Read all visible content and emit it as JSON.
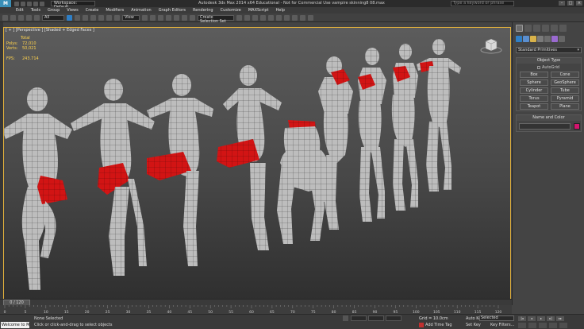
{
  "title_bar": {
    "app_logo": "3ds-max-logo",
    "workspace": "Workspace: Default",
    "title": "Autodesk 3ds Max  2014 x64  Educational - Not for Commercial Use   vampire skinning8 08.max",
    "search_placeholder": "Type a keyword or phrase"
  },
  "menu": [
    "Edit",
    "Tools",
    "Group",
    "Views",
    "Create",
    "Modifiers",
    "Animation",
    "Graph Editors",
    "Rendering",
    "Customize",
    "MAXScript",
    "Help"
  ],
  "toolbar": {
    "selection_filter": "All",
    "ref_coord": "View",
    "named_selection": "Create Selection Set"
  },
  "viewport": {
    "label": "[ + ] [Perspective ] [Shaded + Edged Faces ]",
    "stats": {
      "header": "Total",
      "polys_label": "Polys:",
      "polys": "72,010",
      "verts_label": "Verts:",
      "verts": "50,021",
      "fps_label": "FPS:",
      "fps": "243.714"
    }
  },
  "command_panel": {
    "category": "Standard Primitives",
    "object_type_header": "Object Type",
    "autogrid": "AutoGrid",
    "buttons": [
      "Box",
      "Cone",
      "Sphere",
      "GeoSphere",
      "Cylinder",
      "Tube",
      "Torus",
      "Pyramid",
      "Teapot",
      "Plane"
    ],
    "name_color_header": "Name and Color",
    "color": "#d4146e"
  },
  "timeline": {
    "frame": "0 / 120",
    "ticks": [
      "0",
      "5",
      "10",
      "15",
      "20",
      "25",
      "30",
      "35",
      "40",
      "45",
      "50",
      "55",
      "60",
      "65",
      "70",
      "75",
      "80",
      "85",
      "90",
      "95",
      "100",
      "105",
      "110",
      "115",
      "120"
    ]
  },
  "status": {
    "welcome": "Welcome to M",
    "selection": "None Selected",
    "prompt": "Click or click-and-drag to select objects",
    "grid": "Grid = 10.0cm",
    "add_time_tag": "Add Time Tag",
    "auto_key": "Auto Key",
    "set_key": "Set Key",
    "key_mode": "Selected",
    "key_filters": "Key Filters..."
  }
}
